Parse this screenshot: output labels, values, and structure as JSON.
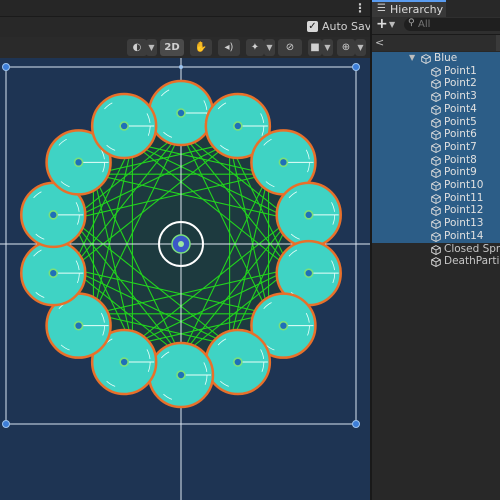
{
  "scene": {
    "autosave_label": "Auto Save",
    "autosave_checked": "✓",
    "view_mode_label": "2D",
    "kebab": "⋮"
  },
  "hierarchy": {
    "tab_label": "Hierarchy",
    "search_placeholder": "All",
    "add_label": "+",
    "root": "Blue",
    "children": [
      "Point1",
      "Point2",
      "Point3",
      "Point4",
      "Point5",
      "Point6",
      "Point7",
      "Point8",
      "Point9",
      "Point10",
      "Point11",
      "Point12",
      "Point13",
      "Point14",
      "Closed Sprite",
      "DeathParticle"
    ]
  },
  "colors": {
    "viewport_bg": "#1e3453",
    "circle_fill": "#3fd3c4",
    "circle_stroke": "#e8702a",
    "line_green": "#22d41e",
    "selection_bg": "#2c5d87",
    "accent": "#5a9cf0"
  },
  "icons": {
    "gameobject": "cube-icon",
    "hierarchy_tab": "list-icon",
    "search": "search-icon"
  }
}
